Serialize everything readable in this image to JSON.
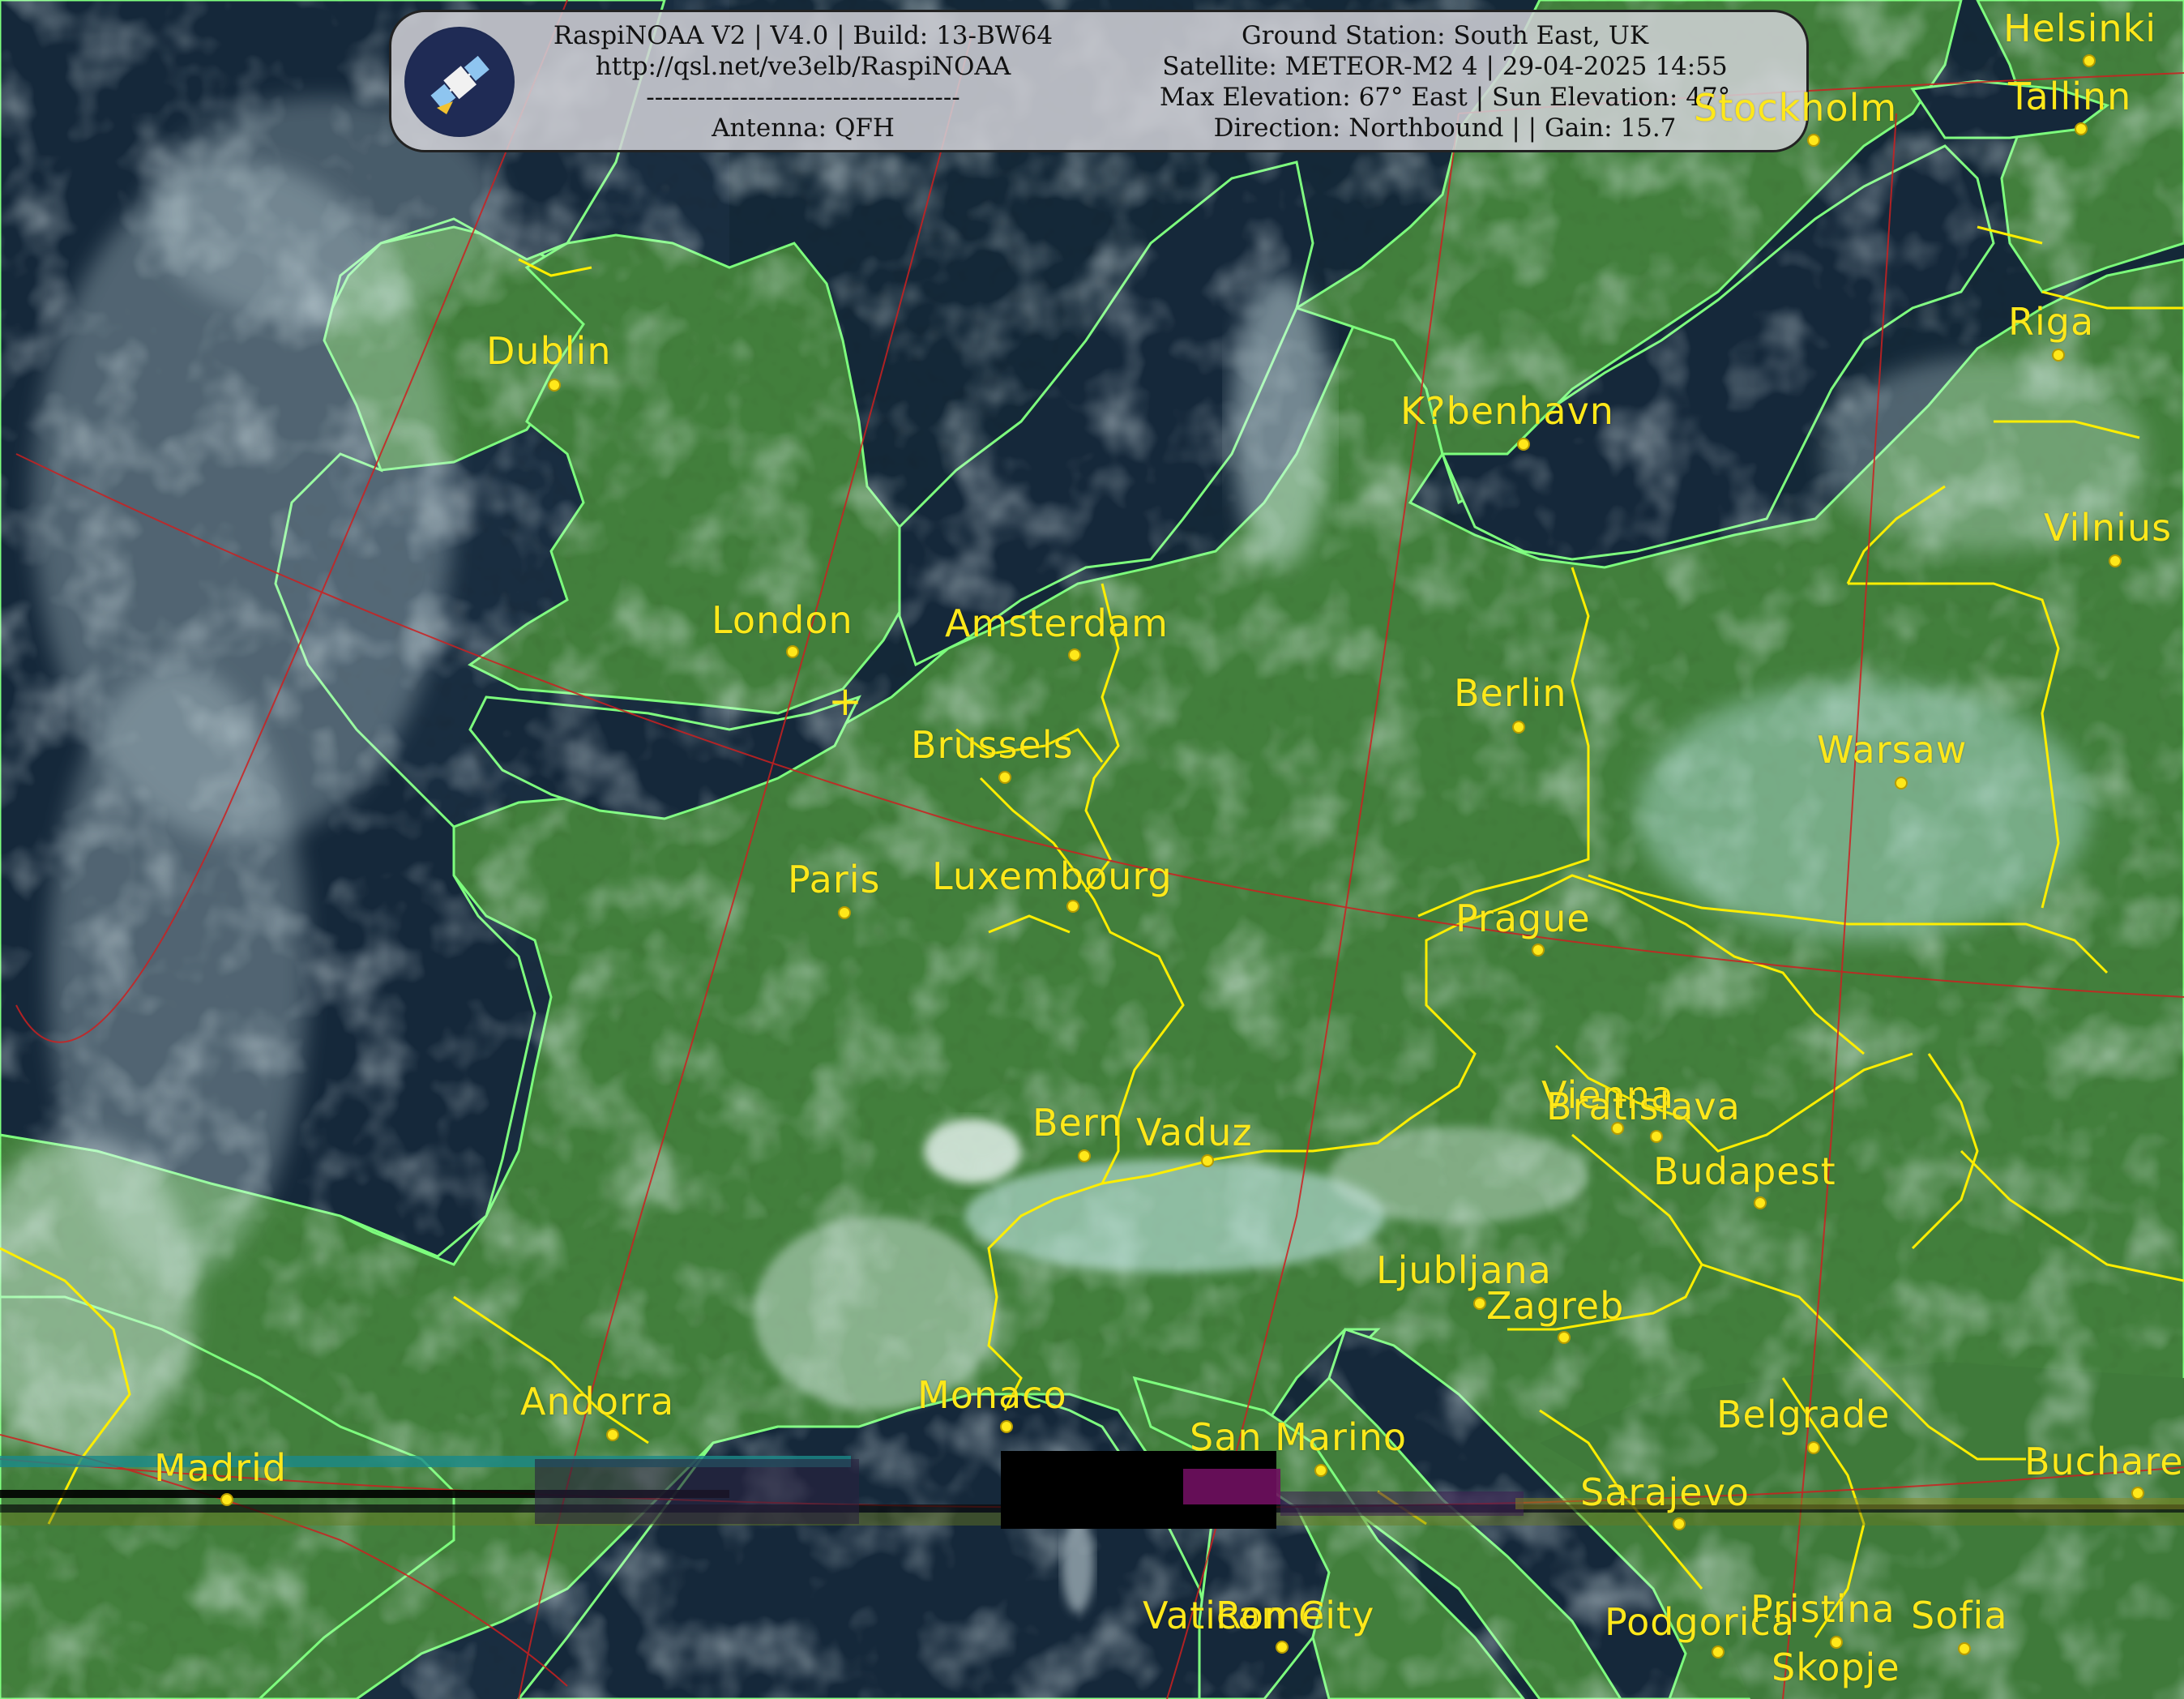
{
  "header": {
    "left_lines": [
      "RaspiNOAA V2 | V4.0 | Build: 13-BW64",
      "http://qsl.net/ve3elb/RaspiNOAA",
      "-------------------------------------",
      "Antenna: QFH"
    ],
    "right_lines": [
      "Ground Station: South East, UK",
      "Satellite: METEOR-M2 4 | 29-04-2025 14:55",
      "Max Elevation: 67° East | Sun Elevation: 47°",
      "Direction: Northbound | | Gain: 15.7"
    ]
  },
  "map": {
    "cities": [
      "Helsinki",
      "Tallinn",
      "Stockholm",
      "Riga",
      "Dublin",
      "K?benhavn",
      "Vilnius",
      "London",
      "Amsterdam",
      "Berlin",
      "Brussels",
      "Warsaw",
      "Paris",
      "Luxembourg",
      "Prague",
      "Vienna",
      "Bratislava",
      "Bern",
      "Vaduz",
      "Budapest",
      "Ljubljana",
      "Zagreb",
      "Andorra",
      "Monaco",
      "San Marino",
      "Belgrade",
      "Madrid",
      "Bucharest",
      "Sarajevo",
      "Vatican City",
      "Rome",
      "Podgorica",
      "Pristina",
      "Sofia",
      "Skopje"
    ],
    "city_color": "#ffe81a",
    "border_color": "#ffee00",
    "coast_color": "#80ff80",
    "grid_color": "#cc2222",
    "land_color": "#3e7d3a",
    "sea_color": "#142636",
    "cloud_color": "#d9f2f5",
    "ground_station_icon": "plus-marker-icon"
  }
}
